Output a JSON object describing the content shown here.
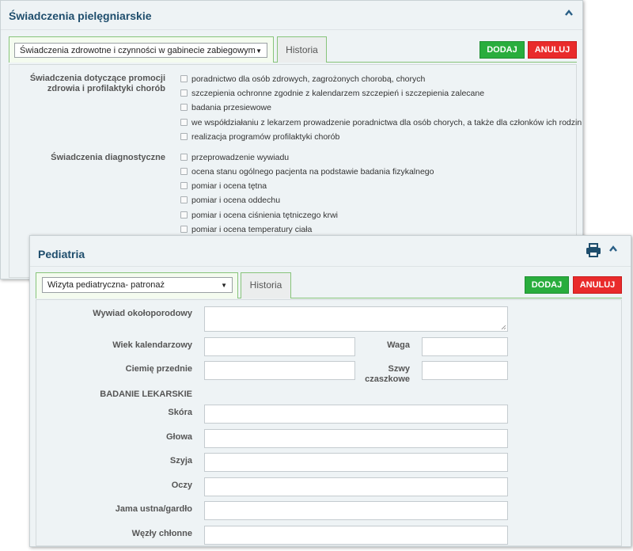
{
  "panel1": {
    "title": "Świadczenia pielęgniarskie",
    "select_value": "Świadczenia zdrowotne i czynności w gabinecie zabiegowym",
    "history_tab": "Historia",
    "add_label": "DODAJ",
    "cancel_label": "ANULUJ",
    "groups": [
      {
        "label": "Świadczenia dotyczące promocji zdrowia i profilaktyki chorób",
        "items": [
          "poradnictwo dla osób zdrowych, zagrożonych chorobą, chorych",
          "szczepienia ochronne zgodnie z kalendarzem szczepień i szczepienia zalecane",
          "badania przesiewowe",
          "we współdziałaniu z lekarzem prowadzenie poradnictwa dla osób chorych, a także dla członków ich rodzin",
          "realizacja programów profilaktyki chorób"
        ]
      },
      {
        "label": "Świadczenia diagnostyczne",
        "items": [
          "przeprowadzenie wywiadu",
          "ocena stanu ogólnego pacjenta na podstawie badania fizykalnego",
          "pomiar i ocena tętna",
          "pomiar i ocena oddechu",
          "pomiar i ocena ciśnienia tętniczego krwi",
          "pomiar i ocena temperatury ciała"
        ]
      }
    ]
  },
  "panel2": {
    "title": "Pediatria",
    "select_value": "Wizyta pediatryczna- patronaż",
    "history_tab": "Historia",
    "add_label": "DODAJ",
    "cancel_label": "ANULUJ",
    "fields": {
      "wywiad": "Wywiad okołoporodowy",
      "wiek": "Wiek kalendarzowy",
      "waga": "Waga",
      "ciemie": "Ciemię przednie",
      "szwy": "Szwy czaszkowe",
      "section": "BADANIE LEKARSKIE",
      "skora": "Skóra",
      "glowa": "Głowa",
      "szyja": "Szyja",
      "oczy": "Oczy",
      "jama": "Jama ustna/gardło",
      "wezly": "Węzły chłonne"
    }
  },
  "colors": {
    "title": "#1f4e6d",
    "green_button": "#29ad3d",
    "red_button": "#e92b2b",
    "tab_border": "#87c47a"
  },
  "icons": {
    "collapse": "chevron-up-icon",
    "print": "printer-icon",
    "dropdown": "caret-down-icon"
  }
}
